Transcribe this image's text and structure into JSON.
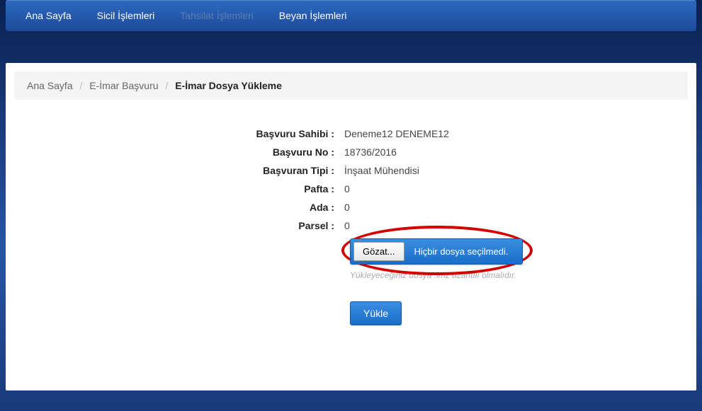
{
  "nav": {
    "items": [
      {
        "label": "Ana Sayfa",
        "disabled": false
      },
      {
        "label": "Sicil İşlemleri",
        "disabled": false
      },
      {
        "label": "Tahsilat İşlemleri",
        "disabled": true
      },
      {
        "label": "Beyan İşlemleri",
        "disabled": false
      }
    ]
  },
  "breadcrumb": {
    "items": [
      {
        "label": "Ana Sayfa"
      },
      {
        "label": "E-İmar Başvuru"
      }
    ],
    "current": "E-İmar Dosya Yükleme"
  },
  "form": {
    "rows": [
      {
        "label": "Başvuru Sahibi :",
        "value": "Deneme12 DENEME12"
      },
      {
        "label": "Başvuru No :",
        "value": "18736/2016"
      },
      {
        "label": "Başvuran Tipi :",
        "value": "İnşaat Mühendisi"
      },
      {
        "label": "Pafta :",
        "value": "0"
      },
      {
        "label": "Ada :",
        "value": "0"
      },
      {
        "label": "Parsel :",
        "value": "0"
      }
    ],
    "browse_label": "Gözat...",
    "file_status": "Hiçbir dosya seçilmedi.",
    "hint": "Yükleyeceğiniz dosya .imz uzantılı olmalıdır.",
    "upload_label": "Yükle"
  }
}
